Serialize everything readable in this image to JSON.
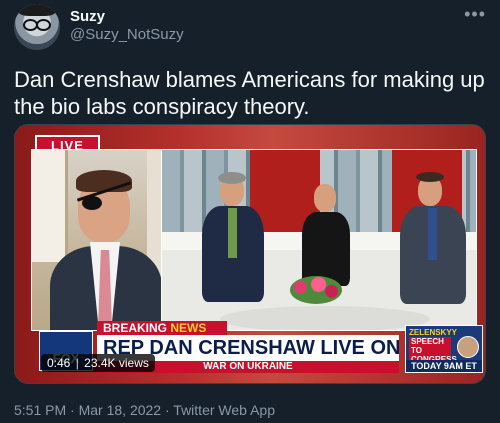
{
  "author": {
    "name": "Suzy",
    "handle": "@Suzy_NotSuzy"
  },
  "more_icon": "more-horizontal-icon",
  "tweet": {
    "text": "Dan Crenshaw blames Americans for making up the bio labs conspiracy theory."
  },
  "video": {
    "live_label": "LIVE",
    "channel_logo": "FOX",
    "breaking_label": "BREAKING",
    "breaking_news": "NEWS",
    "headline": "REP DAN CRENSHAW LIVE ON F&F",
    "subline_prefix": "WAR ON",
    "subline_topic": "UKRAINE",
    "promo_name": "ZELENSKYY",
    "promo_event": "SPEECH TO CONGRESS",
    "promo_time": "TODAY 9AM ET",
    "elapsed": "0:46",
    "views": "23.4K views"
  },
  "footer": {
    "time": "5:51 PM",
    "date": "Mar 18, 2022",
    "client": "Twitter Web App",
    "separator": "·"
  },
  "colors": {
    "background": "#15202b",
    "primary_text": "#f7f9f9",
    "secondary_text": "#8b98a5",
    "fox_red": "#c8102e",
    "fox_blue": "#14367a"
  }
}
